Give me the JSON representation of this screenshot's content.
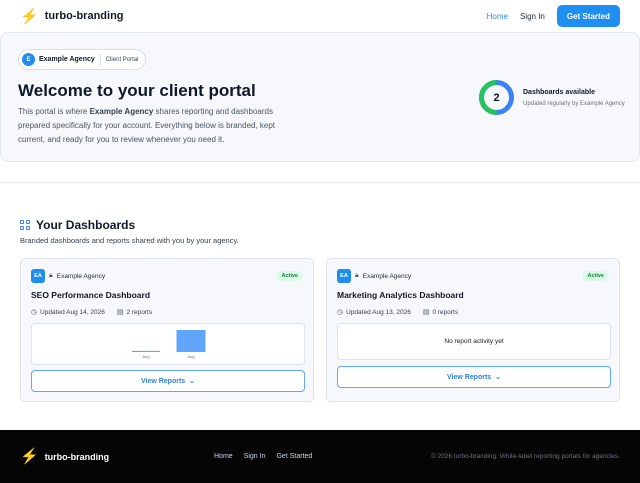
{
  "header": {
    "brand": "turbo-branding",
    "nav": [
      "Home",
      "Sign In"
    ],
    "cta": "Get Started"
  },
  "hero": {
    "avatar_initial": "E",
    "agency_name": "Example Agency",
    "tag": "Client Portal",
    "title": "Welcome to your client portal",
    "text_before": "This portal is where ",
    "text_agency": "Example Agency",
    "text_after": " shares reporting and dashboards prepared specifically for your account. Everything below is branded, kept current, and ready for you to review whenever you need it.",
    "stat_value": "2",
    "stat_title": "Dashboards available",
    "stat_subtitle": "Updated regularly by Example Agency"
  },
  "dashboards": {
    "title": "Your Dashboards",
    "subtitle": "Branded dashboards and reports shared with you by your agency.",
    "cards": [
      {
        "initials": "EA",
        "agency": "Example Agency",
        "status": "Active",
        "title": "SEO Performance Dashboard",
        "updated": "Updated Aug 14, 2026",
        "reports": "2 reports",
        "preview_labels": [
          "Aug",
          "Aug"
        ],
        "preview_values": [
          0.05,
          1.0
        ],
        "button": "View Reports"
      },
      {
        "initials": "EA",
        "agency": "Example Agency",
        "status": "Active",
        "title": "Marketing Analytics Dashboard",
        "updated": "Updated Aug 13, 2026",
        "reports": "0 reports",
        "empty_text": "No report activity yet",
        "button": "View Reports"
      }
    ]
  },
  "footer": {
    "brand": "turbo-branding",
    "nav": [
      "Home",
      "Sign In",
      "Get Started"
    ],
    "copyright": "© 2026 turbo-branding. White-label reporting portals for agencies."
  },
  "colors": {
    "accent": "#1f8ef1",
    "ring_green": "#22c55e",
    "ring_blue": "#3b82f6",
    "badge_green": "#15803d",
    "footer_bg": "#050505"
  }
}
